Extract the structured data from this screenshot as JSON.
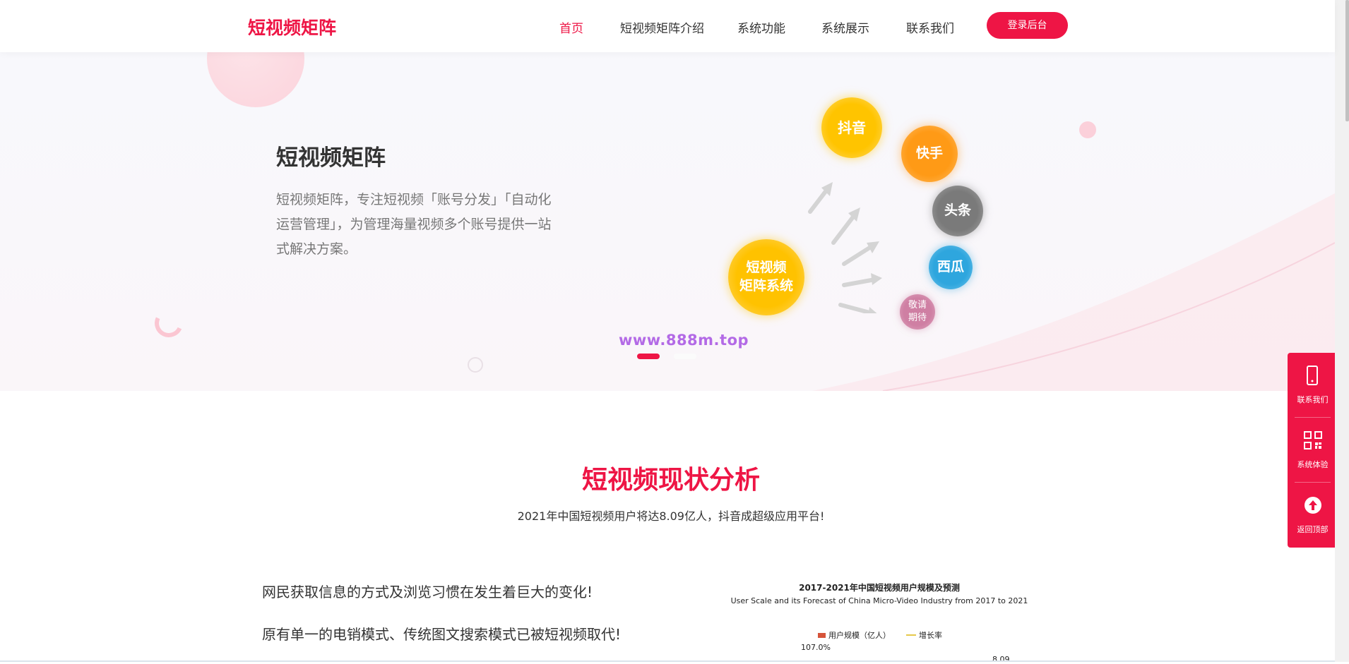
{
  "header": {
    "logo": "短视频矩阵",
    "nav": [
      "首页",
      "短视频矩阵介绍",
      "系统功能",
      "系统展示",
      "联系我们"
    ],
    "login_button": "登录后台"
  },
  "hero": {
    "title": "短视频矩阵",
    "description": "短视频矩阵，专注短视频「账号分发」「自动化运营管理」，为管理海量视频多个账号提供一站式解决方案。",
    "bubbles": {
      "main": "短视频\n矩阵系统",
      "douyin": "抖音",
      "kuaishou": "快手",
      "toutiao": "头条",
      "xigua": "西瓜",
      "coming_soon": "敬请\n期待"
    },
    "watermark": "www.888m.top"
  },
  "section": {
    "title": "短视频现状分析",
    "subtitle": "2021年中国短视频用户将达8.09亿人，抖音成超级应用平台!",
    "line1": "网民获取信息的方式及浏览习惯在发生着巨大的变化!",
    "line2": "原有单一的电销模式、传统图文搜索模式已被短视频取代!"
  },
  "chart_data": {
    "type": "bar",
    "title": "2017-2021年中国短视频用户规模及预测",
    "subtitle": "User Scale and its Forecast of China Micro-Video Industry from 2017 to 2021",
    "legend": [
      "用户规模（亿人）",
      "增长率"
    ],
    "legend_placement": "top",
    "visible_labels": [
      "107.0%",
      "8.09"
    ]
  },
  "sidebar": {
    "contact": "联系我们",
    "demo": "系统体验",
    "top": "返回顶部"
  },
  "colors": {
    "brand": "#ee1545",
    "text": "#333333",
    "muted": "#777777",
    "watermark": "#b36ae6"
  }
}
